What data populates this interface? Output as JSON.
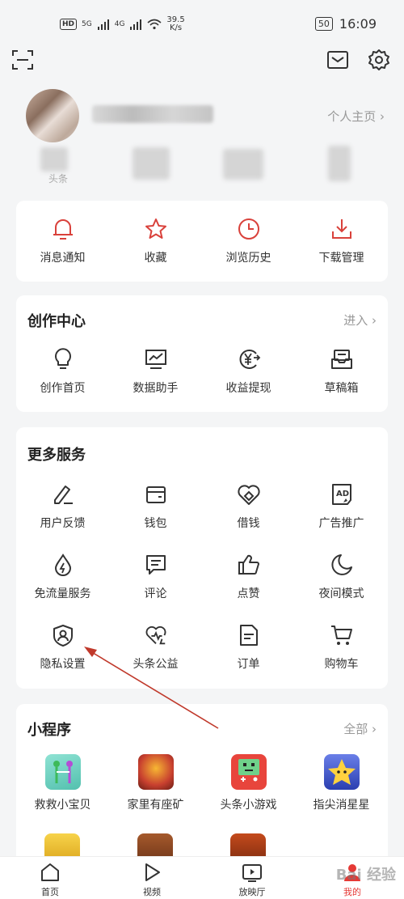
{
  "status_bar": {
    "hd_label": "HD",
    "network_5g": "5G",
    "network_4g": "4G",
    "speed_value": "39.5",
    "speed_unit": "K/s",
    "battery": "50",
    "time": "16:09"
  },
  "profile": {
    "home_link": "个人主页 ›",
    "stat_label_first": "头条"
  },
  "quick_actions": [
    {
      "label": "消息通知",
      "icon": "bell-icon"
    },
    {
      "label": "收藏",
      "icon": "star-icon"
    },
    {
      "label": "浏览历史",
      "icon": "clock-icon"
    },
    {
      "label": "下载管理",
      "icon": "download-icon"
    }
  ],
  "creation_center": {
    "title": "创作中心",
    "more": "进入 ›",
    "items": [
      {
        "label": "创作首页",
        "icon": "lightbulb-icon"
      },
      {
        "label": "数据助手",
        "icon": "chart-monitor-icon"
      },
      {
        "label": "收益提现",
        "icon": "yuan-coin-icon"
      },
      {
        "label": "草稿箱",
        "icon": "draft-box-icon"
      }
    ]
  },
  "more_services": {
    "title": "更多服务",
    "items": [
      {
        "label": "用户反馈",
        "icon": "pen-feedback-icon"
      },
      {
        "label": "钱包",
        "icon": "wallet-icon"
      },
      {
        "label": "借钱",
        "icon": "loan-icon"
      },
      {
        "label": "广告推广",
        "icon": "ad-icon"
      },
      {
        "label": "免流量服务",
        "icon": "data-drop-icon"
      },
      {
        "label": "评论",
        "icon": "comment-icon"
      },
      {
        "label": "点赞",
        "icon": "thumbs-up-icon"
      },
      {
        "label": "夜间模式",
        "icon": "moon-icon"
      },
      {
        "label": "隐私设置",
        "icon": "privacy-shield-icon"
      },
      {
        "label": "头条公益",
        "icon": "charity-heart-icon"
      },
      {
        "label": "订单",
        "icon": "order-doc-icon"
      },
      {
        "label": "购物车",
        "icon": "cart-icon"
      }
    ]
  },
  "mini_programs": {
    "title": "小程序",
    "more": "全部 ›",
    "items": [
      {
        "label": "救救小宝贝",
        "color": "#7fd9c9"
      },
      {
        "label": "家里有座矿",
        "color": "#c8402f"
      },
      {
        "label": "头条小游戏",
        "color": "#e8453c"
      },
      {
        "label": "指尖消星星",
        "color": "#3a5bd0"
      }
    ]
  },
  "bottom_nav": [
    {
      "label": "首页",
      "icon": "home-icon"
    },
    {
      "label": "视频",
      "icon": "play-icon"
    },
    {
      "label": "放映厅",
      "icon": "tv-icon"
    },
    {
      "label": "我的",
      "icon": "user-icon"
    }
  ],
  "watermark": "Bai 经验",
  "colors": {
    "accent": "#d9413b",
    "icon_dark": "#333333",
    "background": "#f4f5f6"
  }
}
